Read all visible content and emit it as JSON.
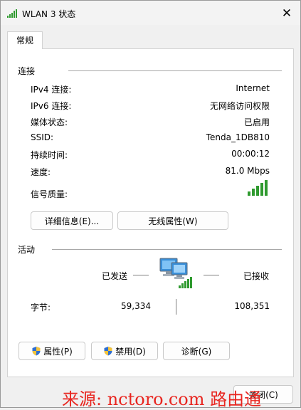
{
  "window": {
    "title": "WLAN 3 状态",
    "close_glyph": "✕"
  },
  "tabs": [
    {
      "label": "常规"
    }
  ],
  "connection": {
    "heading": "连接",
    "rows": [
      {
        "label": "IPv4 连接:",
        "value": "Internet"
      },
      {
        "label": "IPv6 连接:",
        "value": "无网络访问权限"
      },
      {
        "label": "媒体状态:",
        "value": "已启用"
      },
      {
        "label": "SSID:",
        "value": "Tenda_1DB810"
      },
      {
        "label": "持续时间:",
        "value": "00:00:12"
      },
      {
        "label": "速度:",
        "value": "81.0 Mbps"
      }
    ],
    "signal_label": "信号质量:",
    "signal_level": 1.0,
    "details_button": "详细信息(E)...",
    "wireless_button": "无线属性(W)"
  },
  "activity": {
    "heading": "活动",
    "sent_label": "已发送",
    "received_label": "已接收",
    "bytes_label": "字节:",
    "sent_bytes": "59,334",
    "received_bytes": "108,351"
  },
  "footer": {
    "properties_button": "属性(P)",
    "disable_button": "禁用(D)",
    "diagnose_button": "诊断(G)",
    "close_button": "关闭(C)"
  },
  "watermark": "来源: nctoro.com 路由通",
  "colors": {
    "signal": "#2f9a2f",
    "accent": "#0067c0",
    "watermark": "#e8251f"
  }
}
